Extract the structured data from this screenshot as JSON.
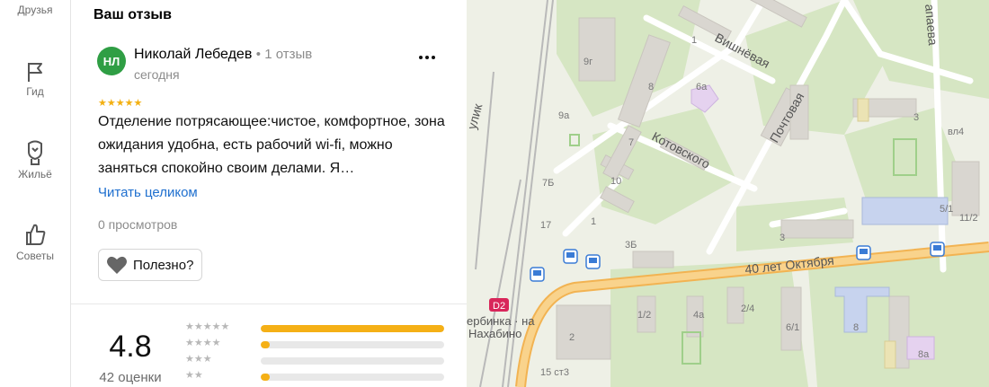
{
  "nav": {
    "items": [
      {
        "label": "Друзья",
        "icon": "friends-icon"
      },
      {
        "label": "Гид",
        "icon": "flag-icon"
      },
      {
        "label": "Жильё",
        "icon": "housing-icon"
      },
      {
        "label": "Советы",
        "icon": "thumbs-up-icon"
      }
    ]
  },
  "review_panel": {
    "title": "Ваш отзыв",
    "author": {
      "initials": "НЛ",
      "name": "Николай Лебедев",
      "review_count": "1 отзыв",
      "date": "сегодня",
      "avatar_color": "#2f9e44"
    },
    "rating_stars": "★★★★★",
    "rating_value": 5,
    "text": "Отделение потрясающее:чистое, комфортное, зона ожидания удобна, есть рабочий wi-fi, можно заняться спокойно своим делами. Я…",
    "read_more": "Читать целиком",
    "views": "0 просмотров",
    "helpful_label": "Полезно?",
    "more_menu": "⋮"
  },
  "summary": {
    "rating": "4.8",
    "ratings_count": "42 оценки",
    "distribution": [
      {
        "stars": "★★★★★",
        "fraction": 1.0
      },
      {
        "stars": "★★★★",
        "fraction": 0.05
      },
      {
        "stars": "★★★",
        "fraction": 0.0
      },
      {
        "stars": "★★",
        "fraction": 0.05
      }
    ],
    "bar_color": "#f5b016"
  },
  "map": {
    "labels": {
      "street_vishnevaya": "Вишнёвая",
      "street_pochtovaya": "Почтовая",
      "street_kotovskogo": "Котовского",
      "street_40_let": "40 лет Октября",
      "street_pereulok": "улик",
      "street_apaeva": "апаева",
      "route": "D2",
      "station": "ербинка · на",
      "station2": "Нахабино"
    },
    "house_numbers": [
      "9г",
      "1",
      "8",
      "6а",
      "9а",
      "7",
      "7Б",
      "10",
      "1",
      "17",
      "3Б",
      "3",
      "3",
      "вл4",
      "5/1",
      "11/2",
      "1/2",
      "4а",
      "2/4",
      "6/1",
      "8",
      "2",
      "15 ст3",
      "8а"
    ]
  },
  "colors": {
    "accent_link": "#1e6fcf",
    "road_major": "#f7c26b",
    "map_bg": "#eef0e6"
  }
}
